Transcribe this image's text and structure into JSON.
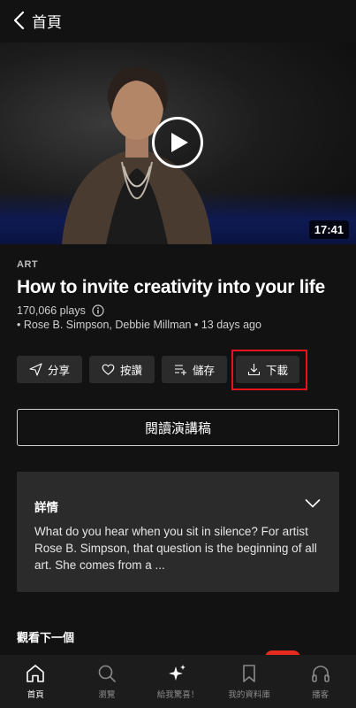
{
  "nav": {
    "back_label": "首頁"
  },
  "video": {
    "duration": "17:41"
  },
  "talk": {
    "category": "ART",
    "title": "How to invite creativity into your life",
    "plays": "170,066 plays",
    "speakers": "• Rose B. Simpson, Debbie Millman • 13 days ago"
  },
  "actions": {
    "share": "分享",
    "like": "按讚",
    "save": "儲存",
    "download": "下載"
  },
  "read_transcript": "閱讀演講稿",
  "details": {
    "heading": "詳情",
    "body": "What do you hear when you sit in silence? For artist Rose B. Simpson, that question is the beginning of all art. She comes from a ..."
  },
  "up_next": "觀看下一個",
  "tabs": [
    {
      "label": "首頁",
      "icon": "home-icon",
      "active": true
    },
    {
      "label": "瀏覽",
      "icon": "search-icon",
      "active": false
    },
    {
      "label": "給我驚喜！",
      "icon": "sparkle-icon",
      "active": false
    },
    {
      "label": "我的資料庫",
      "icon": "bookmark-icon",
      "active": false
    },
    {
      "label": "播客",
      "icon": "headphones-icon",
      "active": false
    }
  ],
  "colors": {
    "accent": "#e8141d",
    "background": "#121212",
    "button": "#2b2b2b"
  }
}
